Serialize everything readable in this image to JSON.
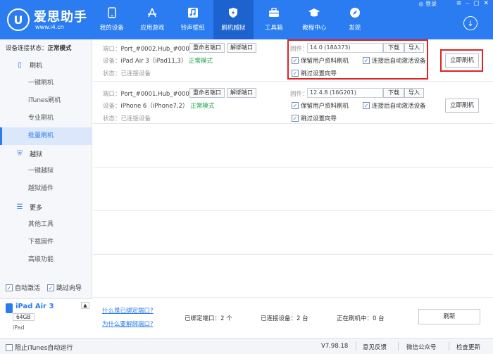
{
  "app": {
    "logo_text": "爱思助手",
    "logo_url": "www.i4.cn",
    "logo_glyph": "U",
    "login": "登录"
  },
  "nav": [
    {
      "label": "我的设备",
      "icon": "phone-icon"
    },
    {
      "label": "应用游戏",
      "icon": "appstore-icon"
    },
    {
      "label": "铃声壁纸",
      "icon": "music-icon"
    },
    {
      "label": "刷机越狱",
      "icon": "flash-shield-icon",
      "active": true
    },
    {
      "label": "工具箱",
      "icon": "toolbox-icon"
    },
    {
      "label": "教程中心",
      "icon": "graduation-icon"
    },
    {
      "label": "发现",
      "icon": "compass-icon"
    }
  ],
  "sidebar": {
    "conn_status_label": "设备连接状态：",
    "conn_status_value": "正常模式",
    "section_flash": "刷机",
    "items_flash": [
      "一键刷机",
      "iTunes刷机",
      "专业刷机",
      "批量刷机"
    ],
    "section_jailbreak": "越狱",
    "items_jailbreak": [
      "一键越狱",
      "越狱插件"
    ],
    "section_more": "更多",
    "items_more": [
      "其他工具",
      "下载固件",
      "高级功能"
    ],
    "auto_activate": "自动激活",
    "skip_guide": "跳过向导",
    "device": {
      "name": "iPad Air 3",
      "capacity": "64GB",
      "type": "iPad"
    }
  },
  "rows": [
    {
      "port_label": "端口：",
      "port_value": "Port_#0002.Hub_#0003",
      "rename": "重命名端口",
      "unbind": "解绑端口",
      "device_label": "设备：",
      "device_value": "iPad Air 3（iPad11,3）",
      "mode": "正常模式",
      "status_label": "状态：",
      "status_value": "已连接设备",
      "firmware_label": "固件：",
      "firmware_value": "14.0 (18A373)",
      "download": "下载",
      "import": "导入",
      "opt_keep": "保留用户资料刷机",
      "opt_auto": "连接后自动激活设备",
      "opt_skip": "跳过设置向导",
      "flash_button": "立即刷机"
    },
    {
      "port_label": "端口：",
      "port_value": "Port_#0001.Hub_#0003",
      "rename": "重命名端口",
      "unbind": "解绑端口",
      "device_label": "设备：",
      "device_value": "iPhone 6（iPhone7,2）",
      "mode": "正常模式",
      "status_label": "状态：",
      "status_value": "已连接设备",
      "firmware_label": "固件：",
      "firmware_value": "12.4.8 (16G201)",
      "download": "下载",
      "import": "导入",
      "opt_keep": "保留用户资料刷机",
      "opt_auto": "连接后自动激活设备",
      "opt_skip": "跳过设置向导",
      "flash_button": "立即刷机"
    }
  ],
  "bottom": {
    "link_bind": "什么是已绑定端口?",
    "link_unbind": "为什么要解绑端口?",
    "bound_ports": "已绑定端口：2 个",
    "connected": "已连接设备：2 台",
    "flashing": "正在刷机中：0 台",
    "refresh": "刷新"
  },
  "statusbar": {
    "block_itunes": "阻止iTunes自动运行",
    "version": "V7.98.18",
    "feedback": "意见反馈",
    "wechat": "微信公众号",
    "check_update": "检查更新"
  },
  "colors": {
    "brand": "#2a7cf0",
    "highlight": "#e02424",
    "normal_mode": "#1aa34a"
  }
}
